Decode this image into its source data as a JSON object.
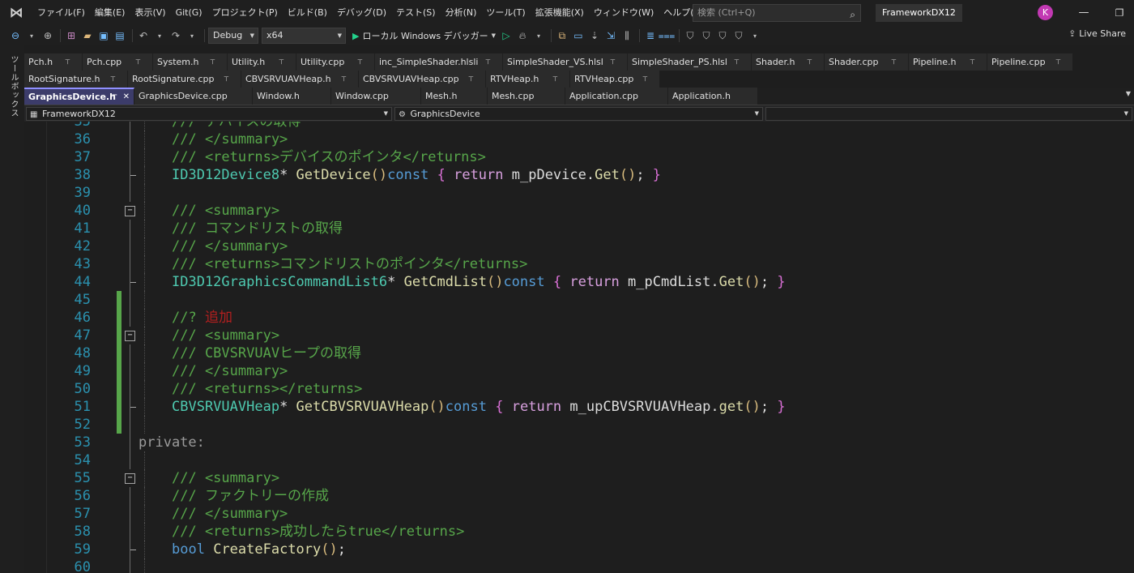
{
  "menubar": {
    "items": [
      "ファイル(F)",
      "編集(E)",
      "表示(V)",
      "Git(G)",
      "プロジェクト(P)",
      "ビルド(B)",
      "デバッグ(D)",
      "テスト(S)",
      "分析(N)",
      "ツール(T)",
      "拡張機能(X)",
      "ウィンドウ(W)",
      "ヘルプ(H)"
    ],
    "search_placeholder": "検索 (Ctrl+Q)",
    "solution_name": "FrameworkDX12",
    "avatar_initial": "K"
  },
  "toolbar": {
    "config": "Debug",
    "platform": "x64",
    "run_label": "ローカル Windows デバッガー",
    "live_share": "Live Share"
  },
  "toolbox_label": "ツールボックス",
  "tabs": {
    "row1": [
      {
        "label": "Pch.h",
        "w": 72
      },
      {
        "label": "Pch.cpp",
        "w": 87
      },
      {
        "label": "System.h",
        "w": 92
      },
      {
        "label": "Utility.h",
        "w": 85
      },
      {
        "label": "Utility.cpp",
        "w": 97
      },
      {
        "label": "inc_SimpleShader.hlsli",
        "w": 158
      },
      {
        "label": "SimpleShader_VS.hlsl",
        "w": 154
      },
      {
        "label": "SimpleShader_PS.hlsl",
        "w": 153
      },
      {
        "label": "Shader.h",
        "w": 90
      },
      {
        "label": "Shader.cpp",
        "w": 104
      },
      {
        "label": "Pipeline.h",
        "w": 97
      },
      {
        "label": "Pipeline.cpp",
        "w": 106
      }
    ],
    "row2": [
      {
        "label": "RootSignature.h",
        "w": 128
      },
      {
        "label": "RootSignature.cpp",
        "w": 140
      },
      {
        "label": "CBVSRVUAVHeap.h",
        "w": 145
      },
      {
        "label": "CBVSRVUAVHeap.cpp",
        "w": 157
      },
      {
        "label": "RTVHeap.h",
        "w": 104
      },
      {
        "label": "RTVHeap.cpp",
        "w": 111
      }
    ],
    "row3": [
      {
        "label": "GraphicsDevice.h",
        "w": 136,
        "active": true
      },
      {
        "label": "GraphicsDevice.cpp",
        "w": 146
      },
      {
        "label": "Window.h",
        "w": 97
      },
      {
        "label": "Window.cpp",
        "w": 111
      },
      {
        "label": "Mesh.h",
        "w": 82
      },
      {
        "label": "Mesh.cpp",
        "w": 96
      },
      {
        "label": "Application.cpp",
        "w": 127
      },
      {
        "label": "Application.h",
        "w": 111
      }
    ],
    "pin_glyph": "⊤",
    "close_glyph": "✕"
  },
  "navbar": {
    "project": "FrameworkDX12",
    "scope": "GraphicsDevice",
    "member": ""
  },
  "code": {
    "lines": [
      {
        "n": "35",
        "tokens": [
          [
            "c-comment",
            "/// デバイスの取得"
          ]
        ],
        "indent": 2,
        "partial": true
      },
      {
        "n": "36",
        "tokens": [
          [
            "c-comment",
            "/// </summary>"
          ]
        ],
        "indent": 2
      },
      {
        "n": "37",
        "tokens": [
          [
            "c-comment",
            "/// <returns>デバイスのポインタ</returns>"
          ]
        ],
        "indent": 2
      },
      {
        "n": "38",
        "tokens": [
          [
            "c-type",
            "ID3D12Device8"
          ],
          [
            "c-plain",
            "* "
          ],
          [
            "c-fn",
            "GetDevice"
          ],
          [
            "c-paren",
            "()"
          ],
          [
            "c-kw",
            "const"
          ],
          [
            "c-plain",
            " "
          ],
          [
            "c-brace",
            "{"
          ],
          [
            "c-plain",
            " "
          ],
          [
            "c-ctrl",
            "return"
          ],
          [
            "c-plain",
            " m_pDevice."
          ],
          [
            "c-fn",
            "Get"
          ],
          [
            "c-paren",
            "()"
          ],
          [
            "c-plain",
            "; "
          ],
          [
            "c-brace",
            "}"
          ]
        ],
        "indent": 2
      },
      {
        "n": "39",
        "tokens": [],
        "indent": 2
      },
      {
        "n": "40",
        "tokens": [
          [
            "c-comment",
            "/// <summary>"
          ]
        ],
        "indent": 2,
        "fold": true
      },
      {
        "n": "41",
        "tokens": [
          [
            "c-comment",
            "/// コマンドリストの取得"
          ]
        ],
        "indent": 2
      },
      {
        "n": "42",
        "tokens": [
          [
            "c-comment",
            "/// </summary>"
          ]
        ],
        "indent": 2
      },
      {
        "n": "43",
        "tokens": [
          [
            "c-comment",
            "/// <returns>コマンドリストのポインタ</returns>"
          ]
        ],
        "indent": 2
      },
      {
        "n": "44",
        "tokens": [
          [
            "c-type",
            "ID3D12GraphicsCommandList6"
          ],
          [
            "c-plain",
            "* "
          ],
          [
            "c-fn",
            "GetCmdList"
          ],
          [
            "c-paren",
            "()"
          ],
          [
            "c-kw",
            "const"
          ],
          [
            "c-plain",
            " "
          ],
          [
            "c-brace",
            "{"
          ],
          [
            "c-plain",
            " "
          ],
          [
            "c-ctrl",
            "return"
          ],
          [
            "c-plain",
            " m_pCmdList."
          ],
          [
            "c-fn",
            "Get"
          ],
          [
            "c-paren",
            "()"
          ],
          [
            "c-plain",
            "; "
          ],
          [
            "c-brace",
            "}"
          ]
        ],
        "indent": 2
      },
      {
        "n": "45",
        "tokens": [],
        "indent": 2,
        "changed": true
      },
      {
        "n": "46",
        "tokens": [
          [
            "c-comment",
            "//? "
          ],
          [
            "c-red",
            "追加"
          ]
        ],
        "indent": 2,
        "changed": true
      },
      {
        "n": "47",
        "tokens": [
          [
            "c-comment",
            "/// <summary>"
          ]
        ],
        "indent": 2,
        "changed": true,
        "fold": true
      },
      {
        "n": "48",
        "tokens": [
          [
            "c-comment",
            "/// CBVSRVUAVヒープの取得"
          ]
        ],
        "indent": 2,
        "changed": true
      },
      {
        "n": "49",
        "tokens": [
          [
            "c-comment",
            "/// </summary>"
          ]
        ],
        "indent": 2,
        "changed": true
      },
      {
        "n": "50",
        "tokens": [
          [
            "c-comment",
            "/// <returns></returns>"
          ]
        ],
        "indent": 2,
        "changed": true
      },
      {
        "n": "51",
        "tokens": [
          [
            "c-type",
            "CBVSRVUAVHeap"
          ],
          [
            "c-plain",
            "* "
          ],
          [
            "c-fn",
            "GetCBVSRVUAVHeap"
          ],
          [
            "c-paren",
            "()"
          ],
          [
            "c-kw",
            "const"
          ],
          [
            "c-plain",
            " "
          ],
          [
            "c-brace",
            "{"
          ],
          [
            "c-plain",
            " "
          ],
          [
            "c-ctrl",
            "return"
          ],
          [
            "c-plain",
            " m_upCBVSRVUAVHeap."
          ],
          [
            "c-fn",
            "get"
          ],
          [
            "c-paren",
            "()"
          ],
          [
            "c-plain",
            "; "
          ],
          [
            "c-brace",
            "}"
          ]
        ],
        "indent": 2,
        "changed": true
      },
      {
        "n": "52",
        "tokens": [],
        "indent": 2,
        "changed": true
      },
      {
        "n": "53",
        "tokens": [
          [
            "c-access",
            "private:"
          ]
        ],
        "indent": 1
      },
      {
        "n": "54",
        "tokens": [],
        "indent": 2
      },
      {
        "n": "55",
        "tokens": [
          [
            "c-comment",
            "/// <summary>"
          ]
        ],
        "indent": 2,
        "fold": true
      },
      {
        "n": "56",
        "tokens": [
          [
            "c-comment",
            "/// ファクトリーの作成"
          ]
        ],
        "indent": 2
      },
      {
        "n": "57",
        "tokens": [
          [
            "c-comment",
            "/// </summary>"
          ]
        ],
        "indent": 2
      },
      {
        "n": "58",
        "tokens": [
          [
            "c-comment",
            "/// <returns>成功したらtrue</returns>"
          ]
        ],
        "indent": 2
      },
      {
        "n": "59",
        "tokens": [
          [
            "c-kw",
            "bool"
          ],
          [
            "c-plain",
            " "
          ],
          [
            "c-fn",
            "CreateFactory"
          ],
          [
            "c-paren",
            "()"
          ],
          [
            "c-plain",
            ";"
          ]
        ],
        "indent": 2
      },
      {
        "n": "60",
        "tokens": [],
        "indent": 2
      }
    ]
  }
}
